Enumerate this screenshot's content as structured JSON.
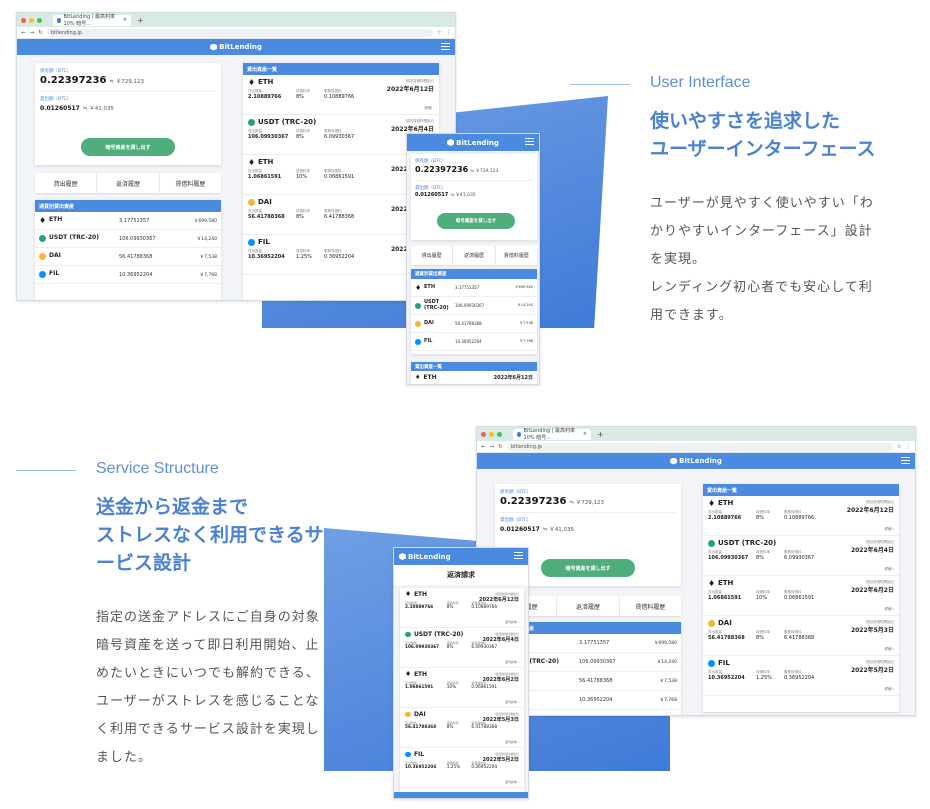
{
  "sections": {
    "ui": {
      "label": "User Interface",
      "heading_line1": "使いやすさを追求した",
      "heading_line2": "ユーザーインターフェース",
      "desc_lines": [
        "ユーザーが見やすく使いやすい「わ",
        "かりやすいインターフェース」設計",
        "を実現。",
        "レンディング初心者でも安心して利",
        "用できます。"
      ]
    },
    "service": {
      "label": "Service Structure",
      "heading_line1": "送金から返金まで",
      "heading_line2": "ストレスなく利用できるサ",
      "heading_line3": "ービス設計",
      "desc_lines": [
        "指定の送金アドレスにご自身の対象",
        "暗号資産を送って即日利用開始、止",
        "めたいときにいつでも解約できる、",
        "ユーザーがストレスを感じることな",
        "く利用できるサービス設計を実現し",
        "ました。"
      ]
    }
  },
  "browser": {
    "tab_title": "BitLending | 最高利率10% 暗号…",
    "url": "bitlending.jp",
    "tab_close": "×",
    "tab_plus": "+"
  },
  "app": {
    "brand": "BitLending",
    "balance_label": "保有額（BTC）",
    "balance": "0.22397236",
    "balance_yen": "≒ ￥729,123",
    "lending_label": "貸出額（BTC）",
    "lending": "0.01260517",
    "lending_yen": "≒ ￥41,035",
    "lend_button": "暗号資産を貸し出す",
    "tabs": [
      "貸出履歴",
      "返済履歴",
      "賃借料履歴"
    ],
    "holdings_title": "通貨別貸出資産",
    "loans_title": "貸出資産一覧",
    "repay_title": "返済請求",
    "holdings": [
      {
        "name": "ETH",
        "amount": "3.17751357",
        "yen": "￥699,580",
        "color": "#222222"
      },
      {
        "name": "USDT (TRC-20)",
        "amount": "106.09930367",
        "yen": "￥14,240",
        "color": "#26a17b"
      },
      {
        "name": "DAI",
        "amount": "56.41788368",
        "yen": "￥7,538",
        "color": "#f4b731"
      },
      {
        "name": "FIL",
        "amount": "10.36952204",
        "yen": "￥7,768",
        "color": "#0090ff"
      }
    ],
    "holdings_mobile": [
      {
        "name": "ETH",
        "amount": "3.17751357",
        "yen": "￥699,580",
        "color": "#222222"
      },
      {
        "name": "USDT\n(TRC-20)",
        "amount": "106.09930367",
        "yen": "￥14,240",
        "color": "#26a17b"
      },
      {
        "name": "DAI",
        "amount": "56.41788368",
        "yen": "￥7,538",
        "color": "#f4b731"
      },
      {
        "name": "FIL",
        "amount": "10.36952204",
        "yen": "￥7,768",
        "color": "#0090ff"
      }
    ],
    "loan_meta": [
      "貸出数量",
      "賃借料率",
      "累積賃借料"
    ],
    "loan_date_label": "前回賃借料開始日",
    "loan_more": "詳細 ›",
    "loans": [
      {
        "name": "ETH",
        "amount": "2.10889766",
        "rate": "8%",
        "fee": "0.10889766",
        "date": "2022年6月12日",
        "color": "#222222"
      },
      {
        "name": "USDT (TRC-20)",
        "amount": "106.09930367",
        "rate": "8%",
        "fee": "6.09930367",
        "date": "2022年6月4日",
        "color": "#26a17b"
      },
      {
        "name": "ETH",
        "amount": "1.06861591",
        "rate": "10%",
        "fee": "0.06861591",
        "date": "2022年6月2日",
        "color": "#222222"
      },
      {
        "name": "DAI",
        "amount": "56.41788368",
        "rate": "8%",
        "fee": "6.41788368",
        "date": "2022年5月3日",
        "color": "#f4b731"
      },
      {
        "name": "FIL",
        "amount": "10.36952204",
        "rate": "1.25%",
        "fee": "0.36952204",
        "date": "2022年5月2日",
        "color": "#0090ff"
      }
    ],
    "repay_more": "返済請求 ›"
  },
  "colors": {
    "accent": "#4a8be0",
    "button": "#4fae7c",
    "heading": "#4a82d1"
  }
}
